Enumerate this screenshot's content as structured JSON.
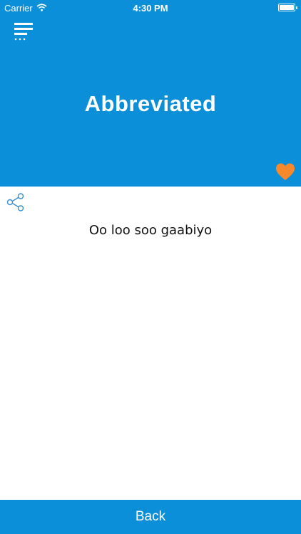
{
  "status_bar": {
    "carrier": "Carrier",
    "time": "4:30 PM",
    "wifi_icon": "wifi-icon",
    "battery_icon": "battery-icon"
  },
  "header": {
    "title": "Abbreviated",
    "menu_icon": "menu-icon",
    "favorite_icon": "heart-icon"
  },
  "content": {
    "share_icon": "share-icon",
    "phrase": "Oo loo soo gaabiyo"
  },
  "footer": {
    "back_label": "Back"
  },
  "colors": {
    "primary": "#0a8fd8",
    "favorite": "#f7892a",
    "text": "#111111",
    "share": "#3a8fd0"
  }
}
